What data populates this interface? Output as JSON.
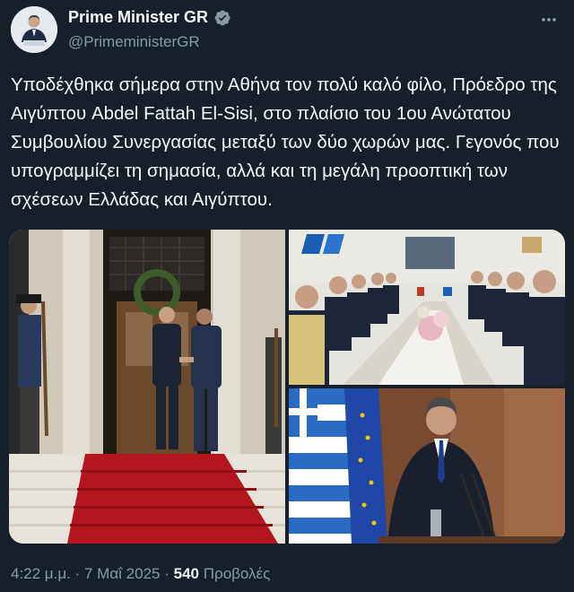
{
  "author": {
    "display_name": "Prime Minister GR",
    "handle": "@PrimeministerGR",
    "verified_icon": "verified-badge-icon",
    "badge_color": "#1d9bf0"
  },
  "more_icon": "more-options-icon",
  "tweet_text": "Υποδέχθηκα σήμερα στην Αθήνα τον πολύ καλό φίλο, Πρόεδρο της Αιγύπτου Abdel Fattah El-Sisi, στο πλαίσιο του 1ου Ανώτατου Συμβουλίου Συνεργασίας μεταξύ των δύο χωρών μας. Γεγονός που υπογραμμίζει τη σημασία, αλλά και τη μεγάλη προοπτική των σχέσεων Ελλάδας και Αιγύπτου.",
  "footer": {
    "time": "4:22 μ.μ.",
    "separator": "·",
    "date": "7 Μαΐ 2025",
    "views_count": "540",
    "views_label": "Προβολές"
  },
  "colors": {
    "background": "#15202b",
    "text": "#f7f9f9",
    "secondary_text": "#8b98a5"
  }
}
